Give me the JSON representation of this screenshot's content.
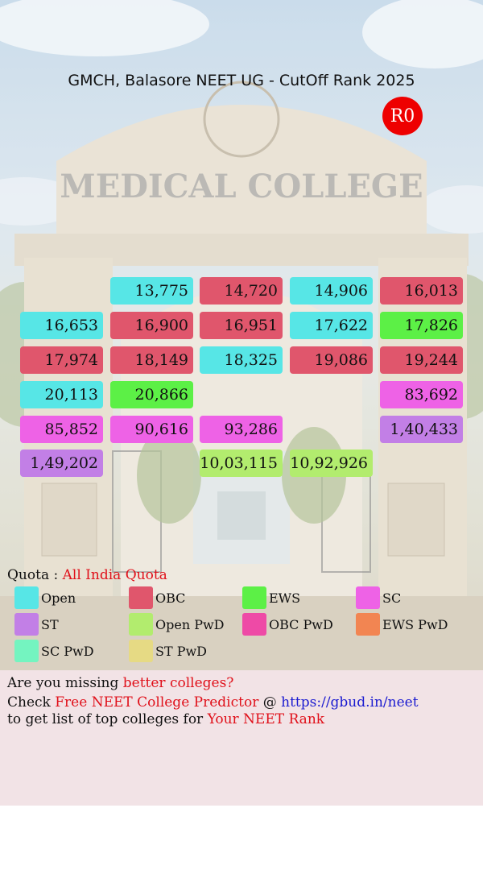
{
  "title": "GMCH, Balasore NEET UG - CutOff Rank 2025",
  "round_badge": "R0",
  "category_colors": {
    "Open": "#57e6e6",
    "OBC": "#e0566c",
    "EWS": "#5cf046",
    "SC": "#ee62e6",
    "ST": "#c27fe6",
    "Open PwD": "#b2ec6e",
    "OBC PwD": "#ee4aa6",
    "EWS PwD": "#f28552",
    "SC PwD": "#74f4c0",
    "ST PwD": "#e6da84"
  },
  "chart_data": {
    "type": "table",
    "title": "GMCH, Balasore NEET UG - CutOff Rank 2025",
    "round": "R0",
    "quota": "All India Quota",
    "cells": [
      {
        "rank": "13,775",
        "category": "Open"
      },
      {
        "rank": "14,720",
        "category": "OBC"
      },
      {
        "rank": "14,906",
        "category": "Open"
      },
      {
        "rank": "16,013",
        "category": "OBC"
      },
      {
        "rank": "16,653",
        "category": "Open"
      },
      {
        "rank": "16,900",
        "category": "OBC"
      },
      {
        "rank": "16,951",
        "category": "OBC"
      },
      {
        "rank": "17,622",
        "category": "Open"
      },
      {
        "rank": "17,826",
        "category": "EWS"
      },
      {
        "rank": "17,974",
        "category": "OBC"
      },
      {
        "rank": "18,149",
        "category": "OBC"
      },
      {
        "rank": "18,325",
        "category": "Open"
      },
      {
        "rank": "19,086",
        "category": "OBC"
      },
      {
        "rank": "19,244",
        "category": "OBC"
      },
      {
        "rank": "20,113",
        "category": "Open"
      },
      {
        "rank": "20,866",
        "category": "EWS"
      },
      {
        "rank": "83,692",
        "category": "SC"
      },
      {
        "rank": "85,852",
        "category": "SC"
      },
      {
        "rank": "90,616",
        "category": "SC"
      },
      {
        "rank": "93,286",
        "category": "SC"
      },
      {
        "rank": "1,40,433",
        "category": "ST"
      },
      {
        "rank": "1,49,202",
        "category": "ST"
      },
      {
        "rank": "10,03,115",
        "category": "Open PwD"
      },
      {
        "rank": "10,92,926",
        "category": "Open PwD"
      }
    ]
  },
  "legend": {
    "quota_label": "Quota :",
    "quota_value": "All India Quota",
    "items": [
      "Open",
      "OBC",
      "EWS",
      "SC",
      "ST",
      "Open PwD",
      "OBC PwD",
      "EWS PwD",
      "SC PwD",
      "ST PwD"
    ]
  },
  "promo": {
    "line1_a": "Are you missing ",
    "line1_b": "better colleges?",
    "line2_a": "Check ",
    "line2_b": "Free NEET College Predictor",
    "line2_c": " @ ",
    "line2_link": "https://gbud.in/neet",
    "line3_a": "to get list of top colleges for ",
    "line3_b": "Your NEET Rank"
  }
}
